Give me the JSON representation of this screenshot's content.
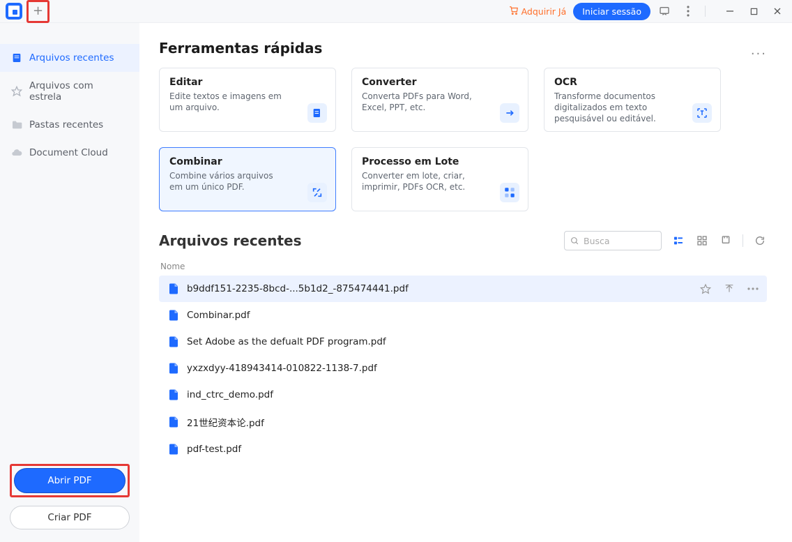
{
  "titlebar": {
    "buy": "Adquirir Já",
    "signin": "Iniciar sessão"
  },
  "sidebar": {
    "items": [
      {
        "label": "Arquivos recentes"
      },
      {
        "label": "Arquivos com estrela"
      },
      {
        "label": "Pastas recentes"
      },
      {
        "label": "Document Cloud"
      }
    ],
    "open_pdf": "Abrir PDF",
    "create_pdf": "Criar PDF"
  },
  "quick_tools": {
    "title": "Ferramentas rápidas",
    "cards": [
      {
        "title": "Editar",
        "desc": "Edite textos e imagens em um arquivo."
      },
      {
        "title": "Converter",
        "desc": "Converta PDFs para Word, Excel, PPT, etc."
      },
      {
        "title": "OCR",
        "desc": "Transforme documentos digitalizados em texto pesquisável ou editável."
      },
      {
        "title": "Combinar",
        "desc": "Combine vários arquivos em um único PDF."
      },
      {
        "title": "Processo em Lote",
        "desc": "Converter em lote, criar, imprimir, PDFs OCR, etc."
      }
    ]
  },
  "recent": {
    "title": "Arquivos recentes",
    "search_placeholder": "Busca",
    "col_name": "Nome",
    "files": [
      {
        "name": "b9ddf151-2235-8bcd-...5b1d2_-875474441.pdf"
      },
      {
        "name": "Combinar.pdf"
      },
      {
        "name": "Set Adobe as the defualt PDF program.pdf"
      },
      {
        "name": "yxzxdyy-418943414-010822-1138-7.pdf"
      },
      {
        "name": "ind_ctrc_demo.pdf"
      },
      {
        "name": "21世纪资本论.pdf"
      },
      {
        "name": "pdf-test.pdf"
      }
    ]
  }
}
